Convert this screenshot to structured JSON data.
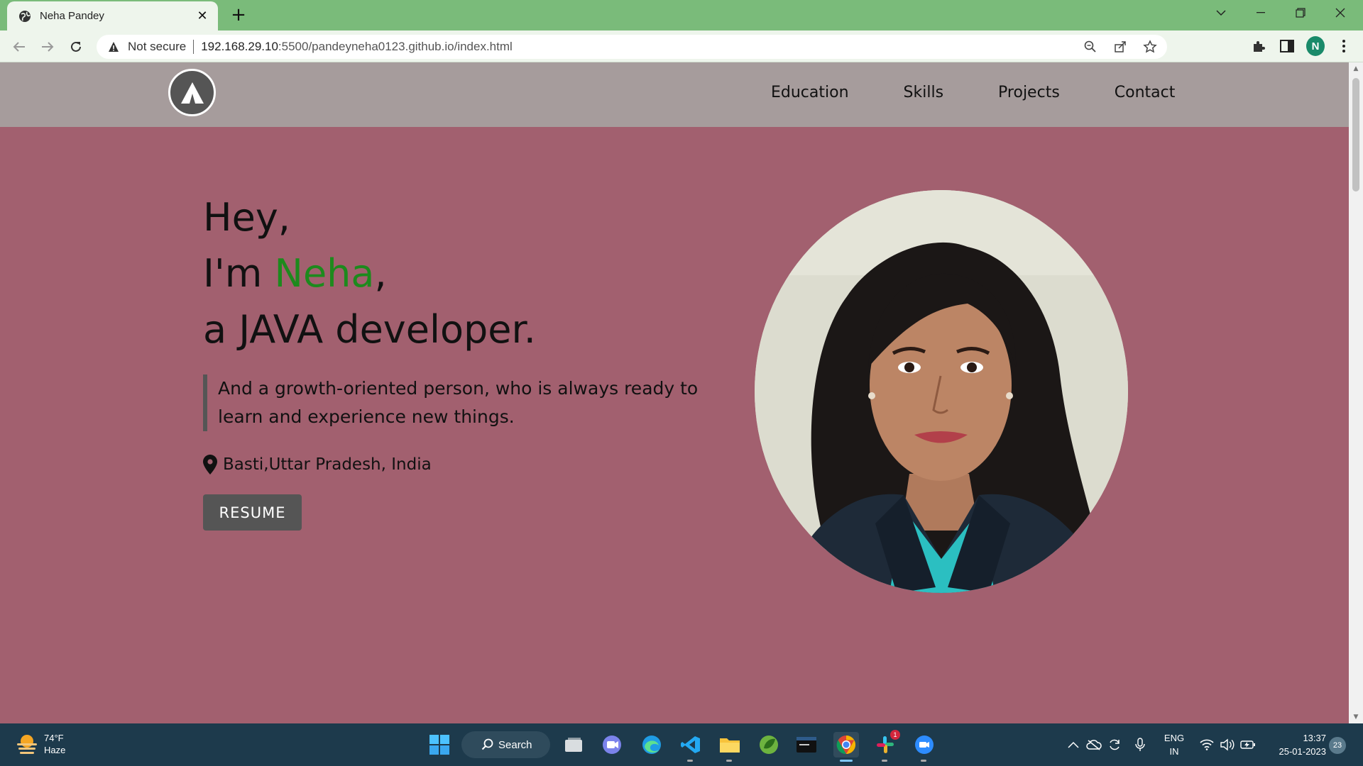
{
  "browser": {
    "tab_title": "Neha Pandey",
    "security_label": "Not secure",
    "url_host": "192.168.29.10",
    "url_rest": ":5500/pandeyneha0123.github.io/index.html",
    "profile_initial": "N"
  },
  "site": {
    "nav": [
      "Education",
      "Skills",
      "Projects",
      "Contact"
    ],
    "hero": {
      "line1": "Hey,",
      "line2_prefix": "I'm ",
      "line2_name": "Neha",
      "line2_suffix": ",",
      "line3": "a JAVA developer."
    },
    "tagline": "And a growth-oriented person, who is always ready to learn and experience new things.",
    "location": "Basti,Uttar Pradesh, India",
    "resume_label": "RESUME"
  },
  "taskbar": {
    "weather_temp": "74°F",
    "weather_desc": "Haze",
    "search_label": "Search",
    "slack_badge": "1",
    "lang_line1": "ENG",
    "lang_line2": "IN",
    "time": "13:37",
    "date": "25-01-2023",
    "notification_count": "23"
  },
  "colors": {
    "page_bg": "#a2606f",
    "nav_bg": "#a69c9c",
    "name_accent": "#1d8a1d",
    "button_bg": "#555555",
    "tabbar_bg": "#7abb7a",
    "taskbar_bg": "#1d3a4c"
  }
}
